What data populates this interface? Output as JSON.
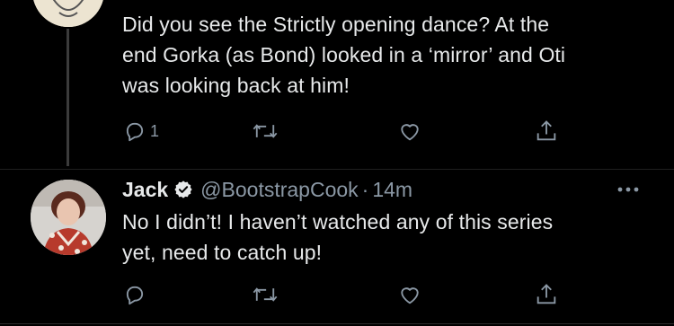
{
  "tweet1": {
    "text_lines": [
      "Did you see the Strictly opening dance?  At the",
      "end Gorka (as Bond) looked in a ‘mirror’ and Oti",
      "was looking back at him!"
    ],
    "reply_count": "1",
    "icons": [
      "reply-icon",
      "retweet-icon",
      "like-icon",
      "share-icon"
    ]
  },
  "tweet2": {
    "display_name": "Jack",
    "handle": "@BootstrapCook",
    "separator": "·",
    "time": "14m",
    "text_lines": [
      "No I didn’t! I haven’t watched any of this series",
      "yet, need to catch up!"
    ],
    "icons": [
      "verified-badge-icon",
      "more-options-icon",
      "reply-icon",
      "retweet-icon",
      "like-icon",
      "share-icon"
    ]
  },
  "colors": {
    "background": "#000000",
    "text": "#e7e9ea",
    "secondary": "#8b98a5",
    "thread_line": "#3b3b3b"
  }
}
